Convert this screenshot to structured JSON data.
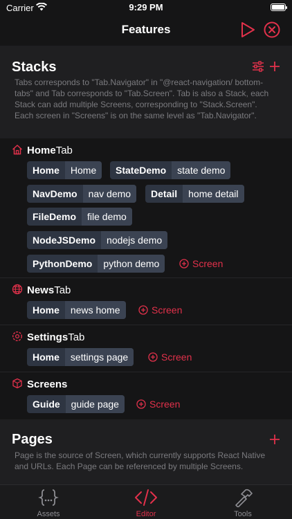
{
  "status": {
    "carrier": "Carrier",
    "time": "9:29 PM"
  },
  "header": {
    "title": "Features",
    "run_icon": "play-icon",
    "close_icon": "close-circle-icon"
  },
  "stacks": {
    "title": "Stacks",
    "description": "Tabs corresponds to \"Tab.Navigator\" in \"@react-navigation/ bottom-tabs\" and Tab corresponds to \"Tab.Screen\". Tab is also a Stack, each Stack can add multiple Screens, corresponding to \"Stack.Screen\". Each screen in \"Screens\" is on the same level as \"Tab.Navigator\".",
    "tabs": [
      {
        "name_strong": "Home",
        "name_suffix": "Tab",
        "icon": "home-icon",
        "screens": [
          {
            "name": "Home",
            "route": "Home"
          },
          {
            "name": "StateDemo",
            "route": "state demo"
          },
          {
            "name": "NavDemo",
            "route": "nav demo"
          },
          {
            "name": "Detail",
            "route": "home detail"
          },
          {
            "name": "FileDemo",
            "route": "file demo"
          },
          {
            "name": "NodeJSDemo",
            "route": "nodejs demo"
          },
          {
            "name": "PythonDemo",
            "route": "python demo"
          }
        ],
        "add_label": "Screen"
      },
      {
        "name_strong": "News",
        "name_suffix": "Tab",
        "icon": "globe-icon",
        "screens": [
          {
            "name": "Home",
            "route": "news home"
          }
        ],
        "add_label": "Screen"
      },
      {
        "name_strong": "Settings",
        "name_suffix": "Tab",
        "icon": "gear-icon",
        "screens": [
          {
            "name": "Home",
            "route": "settings page"
          }
        ],
        "add_label": "Screen"
      },
      {
        "name_strong": "Screens",
        "name_suffix": "",
        "icon": "cube-icon",
        "screens": [
          {
            "name": "Guide",
            "route": "guide page"
          }
        ],
        "add_label": "Screen"
      }
    ]
  },
  "pages": {
    "title": "Pages",
    "description": "Page is the source of Screen, which currently supports React Native and URLs. Each Page can be referenced by multiple Screens."
  },
  "bottom_tabs": [
    {
      "label": "Assets",
      "icon": "braces-icon",
      "active": false
    },
    {
      "label": "Editor",
      "icon": "code-icon",
      "active": true
    },
    {
      "label": "Tools",
      "icon": "hammer-icon",
      "active": false
    }
  ],
  "colors": {
    "accent": "#e2314b",
    "background": "#151516",
    "section": "#1f1f21",
    "chip": "#2e3542",
    "chip_route": "#3b4352"
  }
}
